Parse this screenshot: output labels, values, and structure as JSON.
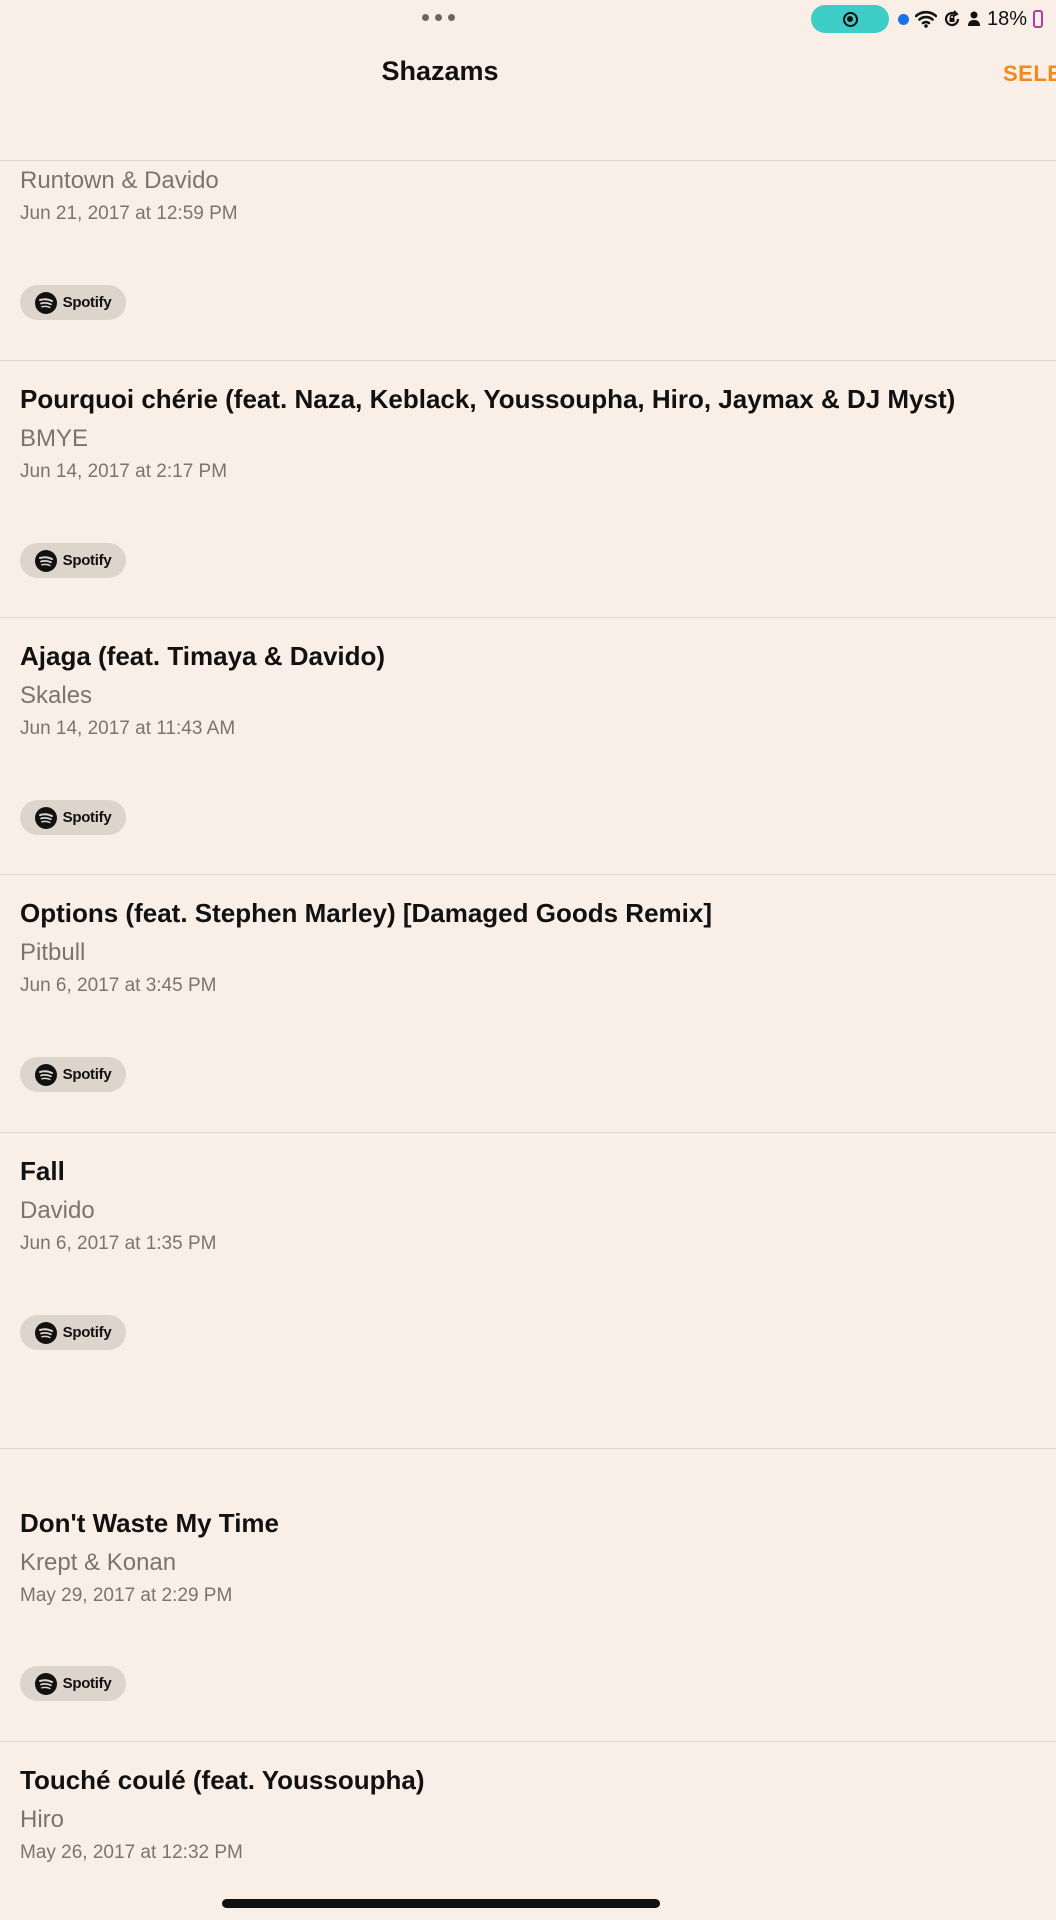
{
  "status_bar": {
    "battery_percent": "18%",
    "icons": [
      "screen-record-icon",
      "location-dot-icon",
      "wifi-icon",
      "rotation-lock-icon",
      "person-icon",
      "battery-icon"
    ]
  },
  "nav": {
    "title": "Shazams",
    "select_label": "SELE"
  },
  "spotify_label": "Spotify",
  "entries": [
    {
      "title": "",
      "artist": "Runtown & Davido",
      "date": "Jun 21, 2017 at 12:59 PM"
    },
    {
      "title": "Pourquoi chérie (feat. Naza, Keblack, Youssoupha, Hiro, Jaymax & DJ Myst)",
      "artist": "BMYE",
      "date": "Jun 14, 2017 at 2:17 PM"
    },
    {
      "title": "Ajaga (feat. Timaya & Davido)",
      "artist": "Skales",
      "date": "Jun 14, 2017 at 11:43 AM"
    },
    {
      "title": "Options (feat. Stephen Marley) [Damaged Goods Remix]",
      "artist": "Pitbull",
      "date": "Jun 6, 2017 at 3:45 PM"
    },
    {
      "title": "Fall",
      "artist": "Davido",
      "date": "Jun 6, 2017 at 1:35 PM"
    },
    {
      "title": "Don't Waste My Time",
      "artist": "Krept & Konan",
      "date": "May 29, 2017 at 2:29 PM"
    },
    {
      "title": "Touché coulé (feat. Youssoupha)",
      "artist": "Hiro",
      "date": "May 26, 2017 at 12:32 PM"
    }
  ],
  "colors": {
    "background": "#F9EFE7",
    "accent": "#F08A1F",
    "record_pill": "#3ECDC6",
    "secondary_text": "#7A7470"
  }
}
